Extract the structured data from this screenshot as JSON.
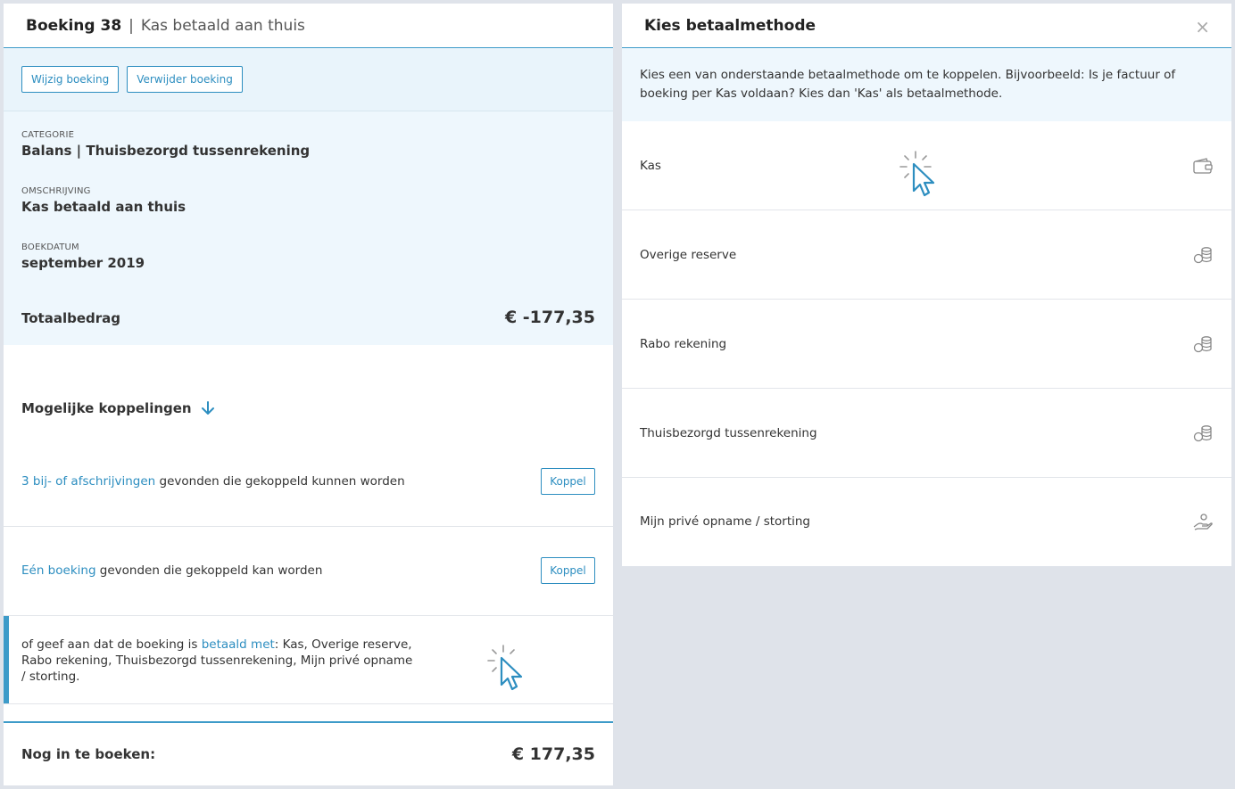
{
  "left": {
    "title": "Boeking 38",
    "separator": "|",
    "subtitle": "Kas betaald aan thuis",
    "buttons": {
      "edit": "Wijzig boeking",
      "delete": "Verwijder boeking"
    },
    "fields": [
      {
        "label": "CATEGORIE",
        "value": "Balans | Thuisbezorgd tussenrekening"
      },
      {
        "label": "OMSCHRIJVING",
        "value": "Kas betaald aan thuis"
      },
      {
        "label": "BOEKDATUM",
        "value": "september 2019"
      }
    ],
    "total_label": "Totaalbedrag",
    "total_value": "€ -177,35",
    "section_title": "Mogelijke koppelingen",
    "matches": [
      {
        "link": "3 bij- of afschrijvingen",
        "text": " gevonden die gekoppeld kunnen worden",
        "button": "Koppel"
      },
      {
        "link": "Eén boeking",
        "text": " gevonden die gekoppeld kan worden",
        "button": "Koppel"
      }
    ],
    "paid": {
      "prefix": "of geef aan dat de boeking is ",
      "link": "betaald met",
      "suffix": ": Kas, Overige reserve, Rabo rekening, Thuisbezorgd tussenrekening, Mijn privé opname / storting."
    },
    "remaining_label": "Nog in te boeken:",
    "remaining_value": "€ 177,35"
  },
  "right": {
    "title": "Kies betaalmethode",
    "close": "×",
    "info": "Kies een van onderstaande betaalmethode om te koppelen. Bijvoorbeeld: Is je factuur of boeking per Kas voldaan? Kies dan 'Kas' als betaalmethode.",
    "methods": [
      {
        "label": "Kas",
        "icon": "wallet-icon"
      },
      {
        "label": "Overige reserve",
        "icon": "coins-icon"
      },
      {
        "label": "Rabo rekening",
        "icon": "coins-icon"
      },
      {
        "label": "Thuisbezorgd tussenrekening",
        "icon": "coins-icon"
      },
      {
        "label": "Mijn privé opname / storting",
        "icon": "hand-money-icon"
      }
    ]
  },
  "colors": {
    "accent": "#2d8ec0",
    "panel_tint": "#eef7fd",
    "background": "#dfe3ea"
  }
}
